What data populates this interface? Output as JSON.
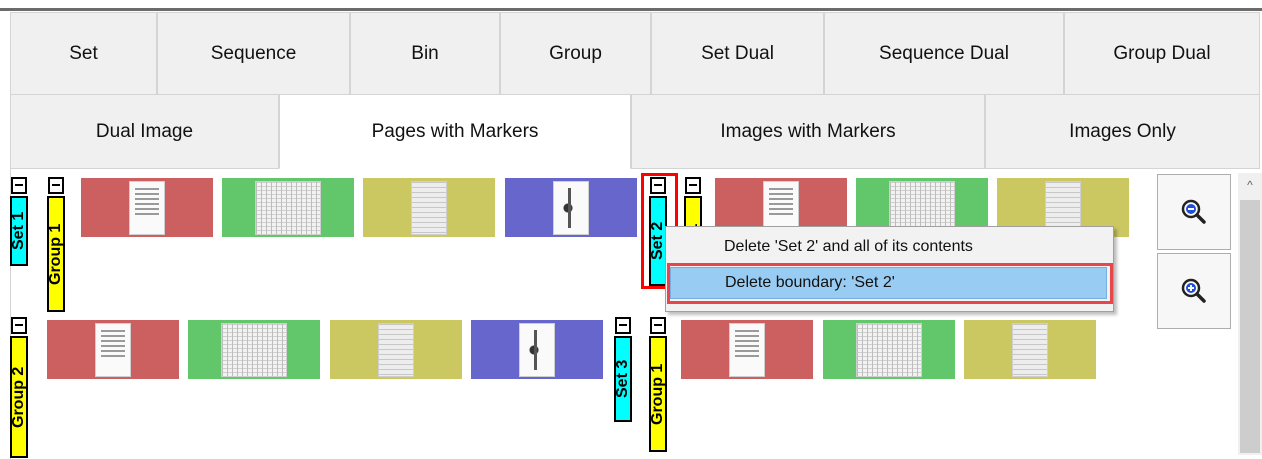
{
  "tabs_row1": [
    "Set",
    "Sequence",
    "Bin",
    "Group",
    "Set Dual",
    "Sequence Dual",
    "Group Dual"
  ],
  "tabs_row2": [
    "Dual Image",
    "Pages with Markers",
    "Images with Markers",
    "Images Only"
  ],
  "active_tab": "Pages with Markers",
  "colors": {
    "red_page": "#cc5f5f",
    "green_page": "#62c66a",
    "yellow_page": "#cbc862",
    "blue_page": "#6666cc",
    "set_label": "#00ffff",
    "group_label": "#ffff00",
    "highlight": "#ff0000",
    "menu_selected": "#99ccf3"
  },
  "markers": {
    "set1": "Set 1",
    "group1_top": "Group 1",
    "set2": "Set 2",
    "group1_hidden": "Group 1",
    "group2": "Group 2",
    "set3": "Set 3",
    "group1_bottom": "Group 1"
  },
  "context_menu": {
    "items": [
      "Delete 'Set 2' and all of its contents",
      "Delete boundary: 'Set 2'"
    ],
    "selected_index": 1
  },
  "zoom": {
    "zoom_out_icon": "magnifier-minus-icon",
    "zoom_in_icon": "magnifier-plus-icon"
  },
  "scrollbar": {
    "up_glyph": "^"
  }
}
